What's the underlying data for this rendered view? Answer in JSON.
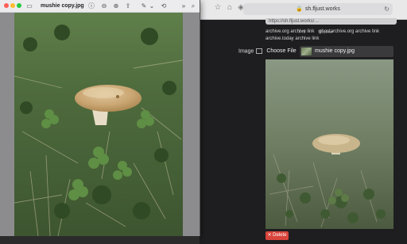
{
  "browser": {
    "address": "sh.fljust.works",
    "url_field": "https://sh.fljust.works/…",
    "view_links": [
      "XYZ",
      "Wayblar"
    ],
    "archive_links": [
      "archive.org archive link",
      "ghostarchive.org archive link",
      "archive.today archive link"
    ],
    "image_label": "Image",
    "choose_file_label": "Choose File",
    "selected_file": "mushie copy.jpg",
    "delete_label": "Delete"
  },
  "preview": {
    "title": "mushie copy.jpg"
  },
  "icons": {
    "close": "close-icon",
    "minimize": "minimize-icon",
    "maximize": "maximize-icon",
    "sidebar": "sidebar-icon",
    "info": "info-icon",
    "zoom_out": "zoom-out-icon",
    "zoom_in": "zoom-in-icon",
    "share": "share-icon",
    "markup": "markup-icon",
    "rotate": "rotate-icon",
    "more": "more-icon",
    "search": "search-icon"
  },
  "colors": {
    "close": "#fe5f57",
    "minimize": "#febc2e",
    "maximize": "#28c840",
    "delete": "#d8443b"
  }
}
